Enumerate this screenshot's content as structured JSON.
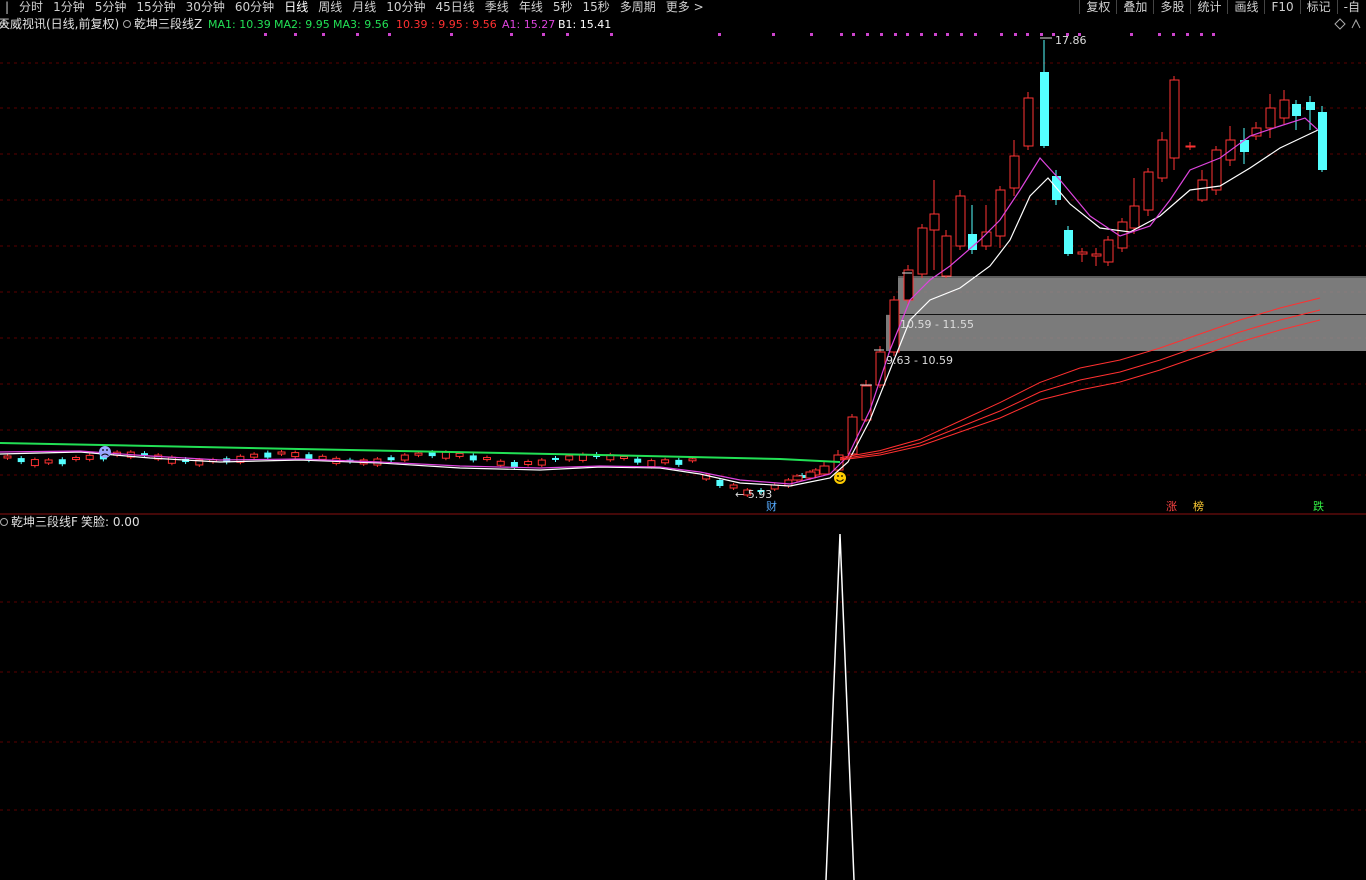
{
  "toolbar": {
    "periods": [
      "分时",
      "1分钟",
      "5分钟",
      "15分钟",
      "30分钟",
      "60分钟",
      "日线",
      "周线",
      "月线",
      "10分钟",
      "45日线",
      "季线",
      "年线",
      "5秒",
      "15秒",
      "多周期",
      "更多 >"
    ],
    "active_period": "日线",
    "right": [
      "复权",
      "叠加",
      "多股",
      "统计",
      "画线",
      "F10",
      "标记",
      "-自"
    ]
  },
  "main_panel": {
    "stock_title": "天威视讯(日线,前复权)",
    "indicator_name": "乾坤三段线Z",
    "legend": [
      {
        "label": "MA1: 10.39",
        "color": "#22e055"
      },
      {
        "label": "MA2: 9.95",
        "color": "#22e055"
      },
      {
        "label": "MA3: 9.56",
        "color": "#22e055"
      },
      {
        "label": "10.39",
        "color": "#ff3030"
      },
      {
        "label": ": 9.95",
        "color": "#ff3030"
      },
      {
        "label": ": 9.56",
        "color": "#ff3030"
      },
      {
        "label": "A1: 15.27",
        "color": "#dd44dd"
      },
      {
        "label": "B1: 15.41",
        "color": "#ffffff"
      }
    ],
    "high_label": "17.86",
    "low_label": "5.93",
    "zone_upper_label": "10.59 - 11.55",
    "zone_lower_label": "9.63 - 10.59",
    "bottom_tags": [
      {
        "text": "财",
        "color": "#55aaff"
      },
      {
        "text": "涨",
        "color": "#ff4444"
      },
      {
        "text": "榜",
        "color": "#ffcc33"
      },
      {
        "text": "跌",
        "color": "#33ee44"
      }
    ],
    "smile_marker": "smile-face",
    "frown_marker": "sad-face"
  },
  "sub_panel": {
    "indicator_name": "乾坤三段线F",
    "value_label": "笑脸: 0.00"
  },
  "colors": {
    "up": "#ff3333",
    "down": "#54ffff",
    "ma_green": "#22e055",
    "line_magenta": "#dd44dd",
    "line_white": "#ffffff",
    "zone_gray": "#909090",
    "grid": "#5a0000"
  }
}
